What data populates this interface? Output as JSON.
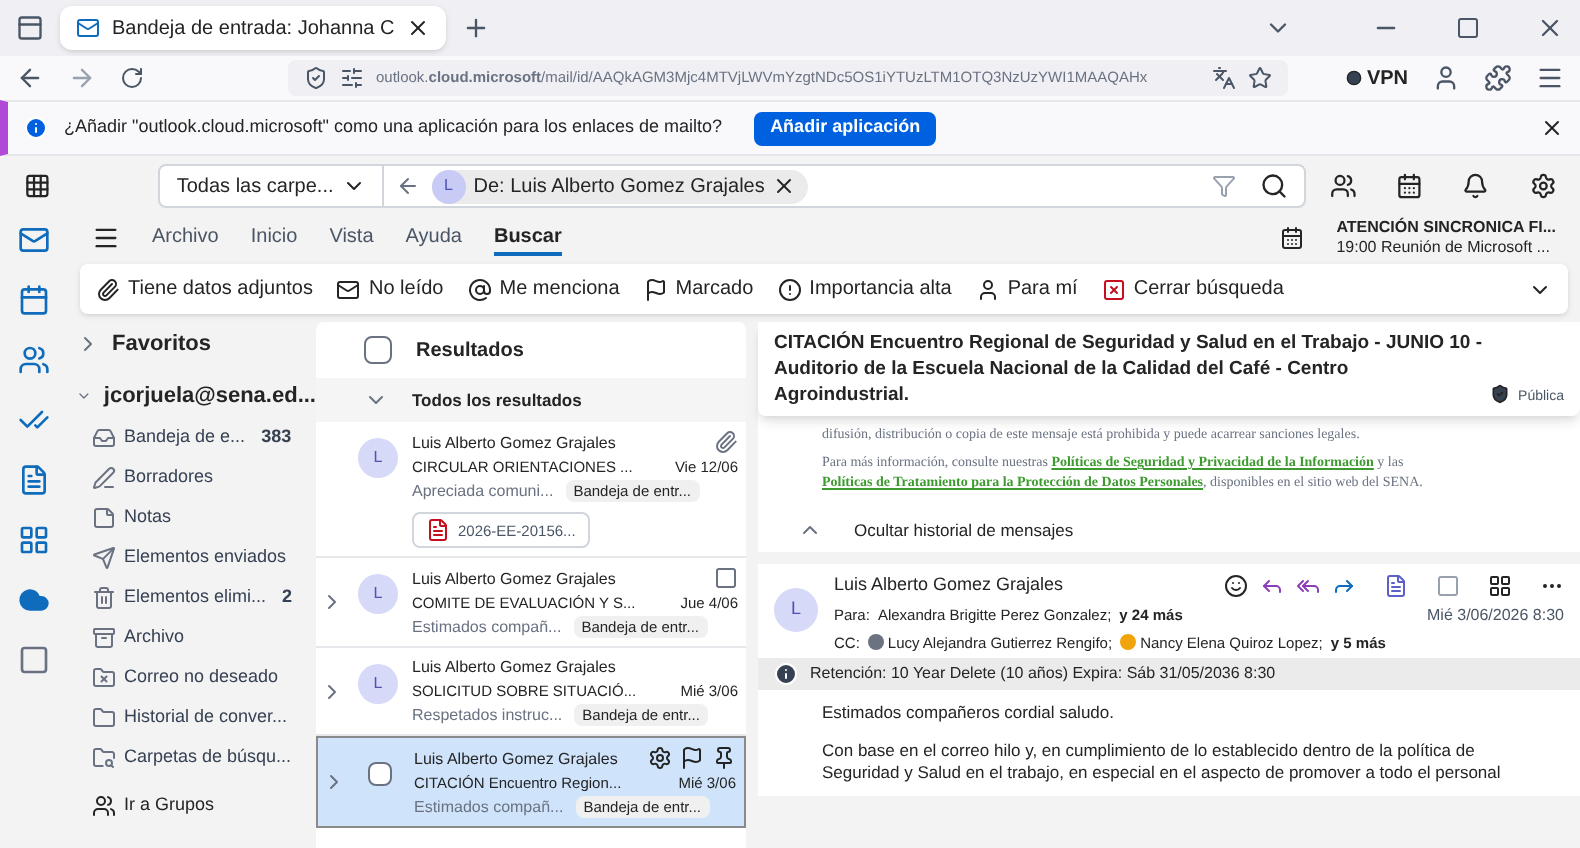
{
  "browser": {
    "tab_title": "Bandeja de entrada: Johanna C",
    "url": "outlook.**cloud.microsoft**/mail/id/AAQkAGM3Mjc4MTVjLWVmYzgtNDc5OS1iYTUzLTM1OTQ3NzUzYWI1MAAQAHx",
    "vpn": "VPN"
  },
  "infobar": {
    "message": "¿Añadir \"outlook.cloud.microsoft\" como una aplicación para los enlaces de mailto?",
    "button": "Añadir aplicación"
  },
  "search": {
    "scope": "Todas las carpe...",
    "chip_initial": "L",
    "chip": "De: Luis Alberto Gomez Grajales"
  },
  "ribbon_tabs": [
    {
      "label": "Archivo",
      "selected": false
    },
    {
      "label": "Inicio",
      "selected": false
    },
    {
      "label": "Vista",
      "selected": false
    },
    {
      "label": "Ayuda",
      "selected": false
    },
    {
      "label": "Buscar",
      "selected": true
    }
  ],
  "reminder": {
    "title": "ATENCIÓN SINCRONICA FI...",
    "subtitle": "19:00 Reunión de Microsoft ..."
  },
  "filters": [
    {
      "label": "Tiene datos adjuntos"
    },
    {
      "label": "No leído"
    },
    {
      "label": "Me menciona"
    },
    {
      "label": "Marcado"
    },
    {
      "label": "Importancia alta"
    },
    {
      "label": "Para mí"
    },
    {
      "label": "Cerrar búsqueda"
    }
  ],
  "folders": {
    "favorites": {
      "label": "Favoritos",
      "expanded": false
    },
    "account": {
      "label": "jcorjuela@sena.ed...",
      "expanded": true
    },
    "items": [
      {
        "label": "Bandeja de e...",
        "count": "383"
      },
      {
        "label": "Borradores"
      },
      {
        "label": "Notas"
      },
      {
        "label": "Elementos enviados"
      },
      {
        "label": "Elementos elimi...",
        "count": "2"
      },
      {
        "label": "Archivo"
      },
      {
        "label": "Correo no deseado"
      },
      {
        "label": "Historial de conver..."
      },
      {
        "label": "Carpetas de búsqu..."
      }
    ],
    "groups": "Ir a Grupos"
  },
  "list": {
    "select_all": {
      "checked": false
    },
    "title": "Resultados",
    "group": {
      "label": "Todos los resultados",
      "expanded": true
    },
    "messages": [
      {
        "initial": "L",
        "sender": "Luis Alberto Gomez Grajales",
        "subject": "CIRCULAR ORIENTACIONES ...",
        "date": "Vie 12/06",
        "preview": "Apreciada comuni...",
        "folder": "Bandeja de entr...",
        "attachment": "2026-EE-20156...",
        "thread": false,
        "selected": false
      },
      {
        "initial": "L",
        "sender": "Luis Alberto Gomez Grajales",
        "subject": "COMITE DE EVALUACIÓN Y S...",
        "date": "Jue 4/06",
        "preview": "Estimados compañ...",
        "folder": "Bandeja de entr...",
        "thread": true,
        "selected": false
      },
      {
        "initial": "L",
        "sender": "Luis Alberto Gomez Grajales",
        "subject": "SOLICITUD SOBRE SITUACIÓ...",
        "date": "Mié 3/06",
        "preview": "Respetados instruc...",
        "folder": "Bandeja de entr...",
        "thread": true,
        "selected": false
      },
      {
        "sender": "Luis Alberto Gomez Grajales",
        "subject": "CITACIÓN Encuentro Region...",
        "date": "Mié 3/06",
        "preview": "Estimados compañ...",
        "folder": "Bandeja de entr...",
        "thread": true,
        "selected": true
      }
    ]
  },
  "reading": {
    "subject": "CITACIÓN Encuentro Regional de Seguridad y Salud en el Trabajo - JUNIO 10 - Auditorio de la Escuela Nacional de la Calidad del Café - Centro Agroindustrial.",
    "sensitivity": "Pública",
    "legal_1": "difusión, distribución o copia de este mensaje está prohibida y puede acarrear sanciones legales.",
    "legal_2_pre": "Para más información, consulte nuestras",
    "link_1": "Políticas de Seguridad y Privacidad de la Información",
    "legal_2_mid": "y las",
    "link_2": "Políticas de Tratamiento para la Protección de Datos Personales",
    "legal_2_post": ", disponibles en el sitio web del SENA.",
    "history": "Ocultar historial de mensajes",
    "message": {
      "initial": "L",
      "sender": "Luis Alberto Gomez Grajales",
      "to_label": "Para:",
      "to": "Alexandra Brigitte Perez Gonzalez;",
      "to_more": "y 24 más",
      "date": "Mié 3/06/2026 8:30",
      "cc_label": "CC:",
      "cc": [
        {
          "name": "Lucy Alejandra Gutierrez Rengifo;",
          "color": "#6b7280"
        },
        {
          "name": "Nancy Elena Quiroz Lopez;",
          "color": "#f0a30a"
        }
      ],
      "cc_more": "y 5 más",
      "retention": "Retención: 10 Year Delete (10 años) Expira: Sáb 31/05/2036 8:30",
      "body": [
        "Estimados compañeros cordial saludo.",
        "Con base en el correo hilo y, en cumplimiento de lo establecido dentro de la política de Seguridad y Salud en el trabajo, en especial en el aspecto de promover a todo el personal"
      ]
    }
  }
}
